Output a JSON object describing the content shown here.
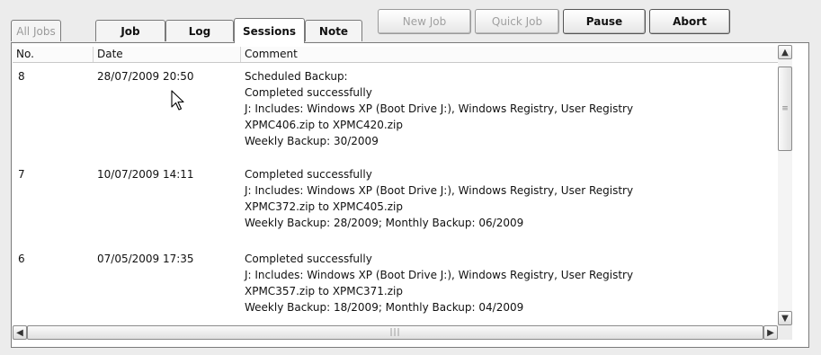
{
  "tabs": [
    {
      "label": "All Jobs",
      "state": "disabled"
    },
    {
      "label": "Job",
      "state": "normal"
    },
    {
      "label": "Log",
      "state": "normal"
    },
    {
      "label": "Sessions",
      "state": "active"
    },
    {
      "label": "Note",
      "state": "normal"
    }
  ],
  "toolbar": {
    "new_job": "New Job",
    "quick_job": "Quick Job",
    "pause": "Pause",
    "abort": "Abort"
  },
  "table": {
    "columns": [
      "No.",
      "Date",
      "Comment"
    ],
    "rows": [
      {
        "no": "8",
        "date": "28/07/2009 20:50",
        "comment": [
          "Scheduled Backup:",
          "Completed successfully",
          "J: Includes: Windows XP (Boot Drive J:), Windows Registry, User Registry",
          "XPMC406.zip to XPMC420.zip",
          "Weekly Backup: 30/2009"
        ]
      },
      {
        "no": "7",
        "date": "10/07/2009 14:11",
        "comment": [
          "Completed successfully",
          "J: Includes: Windows XP (Boot Drive J:), Windows Registry, User Registry",
          "XPMC372.zip to XPMC405.zip",
          "Weekly Backup: 28/2009; Monthly Backup: 06/2009"
        ]
      },
      {
        "no": "6",
        "date": "07/05/2009 17:35",
        "comment": [
          "Completed successfully",
          "J: Includes: Windows XP (Boot Drive J:), Windows Registry, User Registry",
          "XPMC357.zip to XPMC371.zip",
          "Weekly Backup: 18/2009; Monthly Backup: 04/2009"
        ]
      }
    ]
  },
  "icons": {
    "scroll_up": "scroll-up-arrow-icon",
    "scroll_down": "scroll-down-arrow-icon",
    "scroll_left": "scroll-left-arrow-icon",
    "scroll_right": "scroll-right-arrow-icon",
    "cursor": "mouse-pointer-icon"
  }
}
